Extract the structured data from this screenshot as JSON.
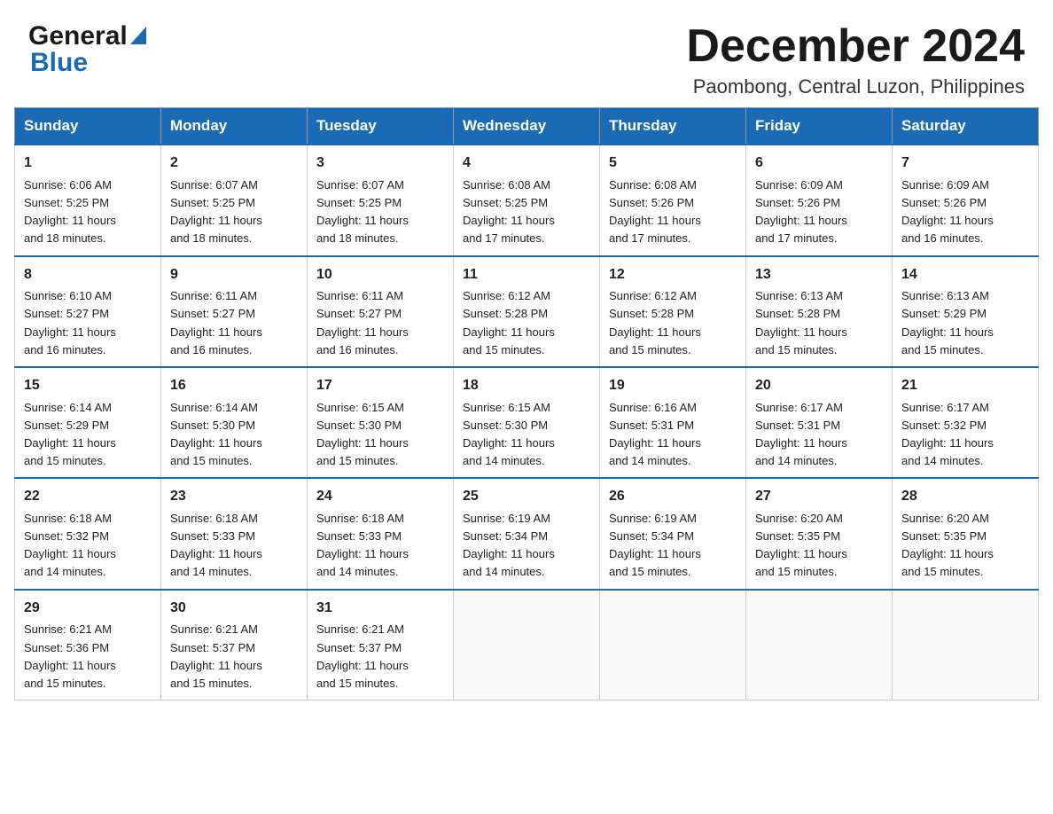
{
  "header": {
    "logo_general": "General",
    "logo_blue": "Blue",
    "title": "December 2024",
    "subtitle": "Paombong, Central Luzon, Philippines"
  },
  "days": [
    "Sunday",
    "Monday",
    "Tuesday",
    "Wednesday",
    "Thursday",
    "Friday",
    "Saturday"
  ],
  "weeks": [
    [
      {
        "date": "1",
        "sunrise": "6:06 AM",
        "sunset": "5:25 PM",
        "daylight": "11 hours and 18 minutes."
      },
      {
        "date": "2",
        "sunrise": "6:07 AM",
        "sunset": "5:25 PM",
        "daylight": "11 hours and 18 minutes."
      },
      {
        "date": "3",
        "sunrise": "6:07 AM",
        "sunset": "5:25 PM",
        "daylight": "11 hours and 18 minutes."
      },
      {
        "date": "4",
        "sunrise": "6:08 AM",
        "sunset": "5:25 PM",
        "daylight": "11 hours and 17 minutes."
      },
      {
        "date": "5",
        "sunrise": "6:08 AM",
        "sunset": "5:26 PM",
        "daylight": "11 hours and 17 minutes."
      },
      {
        "date": "6",
        "sunrise": "6:09 AM",
        "sunset": "5:26 PM",
        "daylight": "11 hours and 17 minutes."
      },
      {
        "date": "7",
        "sunrise": "6:09 AM",
        "sunset": "5:26 PM",
        "daylight": "11 hours and 16 minutes."
      }
    ],
    [
      {
        "date": "8",
        "sunrise": "6:10 AM",
        "sunset": "5:27 PM",
        "daylight": "11 hours and 16 minutes."
      },
      {
        "date": "9",
        "sunrise": "6:11 AM",
        "sunset": "5:27 PM",
        "daylight": "11 hours and 16 minutes."
      },
      {
        "date": "10",
        "sunrise": "6:11 AM",
        "sunset": "5:27 PM",
        "daylight": "11 hours and 16 minutes."
      },
      {
        "date": "11",
        "sunrise": "6:12 AM",
        "sunset": "5:28 PM",
        "daylight": "11 hours and 15 minutes."
      },
      {
        "date": "12",
        "sunrise": "6:12 AM",
        "sunset": "5:28 PM",
        "daylight": "11 hours and 15 minutes."
      },
      {
        "date": "13",
        "sunrise": "6:13 AM",
        "sunset": "5:28 PM",
        "daylight": "11 hours and 15 minutes."
      },
      {
        "date": "14",
        "sunrise": "6:13 AM",
        "sunset": "5:29 PM",
        "daylight": "11 hours and 15 minutes."
      }
    ],
    [
      {
        "date": "15",
        "sunrise": "6:14 AM",
        "sunset": "5:29 PM",
        "daylight": "11 hours and 15 minutes."
      },
      {
        "date": "16",
        "sunrise": "6:14 AM",
        "sunset": "5:30 PM",
        "daylight": "11 hours and 15 minutes."
      },
      {
        "date": "17",
        "sunrise": "6:15 AM",
        "sunset": "5:30 PM",
        "daylight": "11 hours and 15 minutes."
      },
      {
        "date": "18",
        "sunrise": "6:15 AM",
        "sunset": "5:30 PM",
        "daylight": "11 hours and 14 minutes."
      },
      {
        "date": "19",
        "sunrise": "6:16 AM",
        "sunset": "5:31 PM",
        "daylight": "11 hours and 14 minutes."
      },
      {
        "date": "20",
        "sunrise": "6:17 AM",
        "sunset": "5:31 PM",
        "daylight": "11 hours and 14 minutes."
      },
      {
        "date": "21",
        "sunrise": "6:17 AM",
        "sunset": "5:32 PM",
        "daylight": "11 hours and 14 minutes."
      }
    ],
    [
      {
        "date": "22",
        "sunrise": "6:18 AM",
        "sunset": "5:32 PM",
        "daylight": "11 hours and 14 minutes."
      },
      {
        "date": "23",
        "sunrise": "6:18 AM",
        "sunset": "5:33 PM",
        "daylight": "11 hours and 14 minutes."
      },
      {
        "date": "24",
        "sunrise": "6:18 AM",
        "sunset": "5:33 PM",
        "daylight": "11 hours and 14 minutes."
      },
      {
        "date": "25",
        "sunrise": "6:19 AM",
        "sunset": "5:34 PM",
        "daylight": "11 hours and 14 minutes."
      },
      {
        "date": "26",
        "sunrise": "6:19 AM",
        "sunset": "5:34 PM",
        "daylight": "11 hours and 15 minutes."
      },
      {
        "date": "27",
        "sunrise": "6:20 AM",
        "sunset": "5:35 PM",
        "daylight": "11 hours and 15 minutes."
      },
      {
        "date": "28",
        "sunrise": "6:20 AM",
        "sunset": "5:35 PM",
        "daylight": "11 hours and 15 minutes."
      }
    ],
    [
      {
        "date": "29",
        "sunrise": "6:21 AM",
        "sunset": "5:36 PM",
        "daylight": "11 hours and 15 minutes."
      },
      {
        "date": "30",
        "sunrise": "6:21 AM",
        "sunset": "5:37 PM",
        "daylight": "11 hours and 15 minutes."
      },
      {
        "date": "31",
        "sunrise": "6:21 AM",
        "sunset": "5:37 PM",
        "daylight": "11 hours and 15 minutes."
      },
      null,
      null,
      null,
      null
    ]
  ]
}
